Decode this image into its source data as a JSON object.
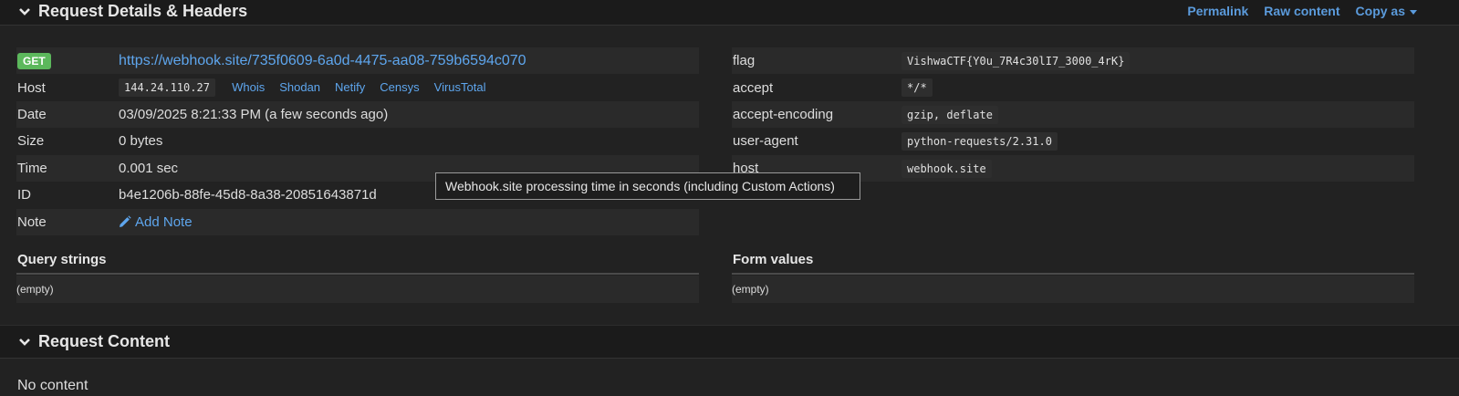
{
  "details": {
    "title": "Request Details & Headers",
    "header_links": [
      "Permalink",
      "Raw content",
      "Copy as"
    ],
    "method": "GET",
    "url": "https://webhook.site/735f0609-6a0d-4475-aa08-759b6594c070",
    "host_label": "Host",
    "host_ip": "144.24.110.27",
    "ip_links": [
      "Whois",
      "Shodan",
      "Netify",
      "Censys",
      "VirusTotal"
    ],
    "date_label": "Date",
    "date_value": "03/09/2025 8:21:33 PM (a few seconds ago)",
    "size_label": "Size",
    "size_value": "0 bytes",
    "time_label": "Time",
    "time_value": "0.001 sec",
    "id_label": "ID",
    "id_value": "b4e1206b-88fe-45d8-8a38-20851643871d",
    "note_label": "Note",
    "note_link": "Add Note"
  },
  "headers": [
    {
      "name": "flag",
      "value": "VishwaCTF{Y0u_7R4c30lI7_3000_4rK}"
    },
    {
      "name": "accept",
      "value": "*/*"
    },
    {
      "name": "accept-encoding",
      "value": "gzip, deflate"
    },
    {
      "name": "user-agent",
      "value": "python-requests/2.31.0"
    },
    {
      "name": "host",
      "value": "webhook.site"
    }
  ],
  "query_strings": {
    "title": "Query strings",
    "value": "(empty)"
  },
  "form_values": {
    "title": "Form values",
    "value": "(empty)"
  },
  "tooltip": "Webhook.site processing time in seconds (including Custom Actions)",
  "content": {
    "title": "Request Content",
    "value": "No content"
  },
  "colors": {
    "badge_get": "#5cb85c",
    "link": "#5ea6ee",
    "background": "#222222"
  }
}
